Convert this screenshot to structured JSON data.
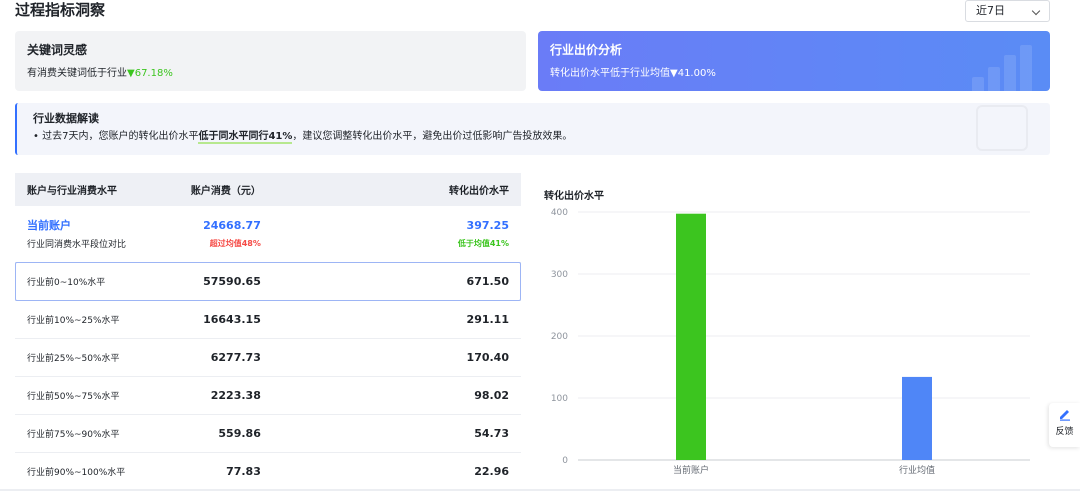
{
  "page": {
    "title": "过程指标洞察"
  },
  "period": {
    "selected": "近7日"
  },
  "card_keyword": {
    "title": "关键词灵感",
    "desc_prefix": "有消费关键词低于行业",
    "arrow": "▼",
    "value": "67.18%"
  },
  "card_bid": {
    "title": "行业出价分析",
    "desc_prefix": "转化出价水平低于行业均值",
    "arrow": "▼",
    "value": "41.00%"
  },
  "insight": {
    "title": "行业数据解读",
    "text_prefix": "• 过去7天内，您账户的转化出价水平",
    "text_highlight": "低于同水平同行41%",
    "text_suffix": "，建议您调整转化出价水平，避免出价过低影响广告投放效果。"
  },
  "table": {
    "headers": [
      "账户与行业消费水平",
      "账户消费（元）",
      "转化出价水平"
    ],
    "current": {
      "label": "当前账户",
      "sub": "行业同消费水平段位对比",
      "spend": "24668.77",
      "spend_note": "超过均值48%",
      "bid": "397.25",
      "bid_note": "低于均值41%"
    },
    "rows": [
      {
        "label": "行业前0~10%水平",
        "spend": "57590.65",
        "bid": "671.50"
      },
      {
        "label": "行业前10%~25%水平",
        "spend": "16643.15",
        "bid": "291.11"
      },
      {
        "label": "行业前25%~50%水平",
        "spend": "6277.73",
        "bid": "170.40"
      },
      {
        "label": "行业前50%~75%水平",
        "spend": "2223.38",
        "bid": "98.02"
      },
      {
        "label": "行业前75%~90%水平",
        "spend": "559.86",
        "bid": "54.73"
      },
      {
        "label": "行业前90%~100%水平",
        "spend": "77.83",
        "bid": "22.96"
      }
    ]
  },
  "chart_data": {
    "type": "bar",
    "title": "转化出价水平",
    "categories": [
      "当前账户",
      "行业均值"
    ],
    "values": [
      397.25,
      134
    ],
    "colors": [
      "#3cc51f",
      "#4f86f7"
    ],
    "ylim": [
      0,
      400
    ],
    "yticks": [
      0,
      100,
      200,
      300,
      400
    ],
    "grid": true
  },
  "feedback": {
    "label": "反馈"
  }
}
